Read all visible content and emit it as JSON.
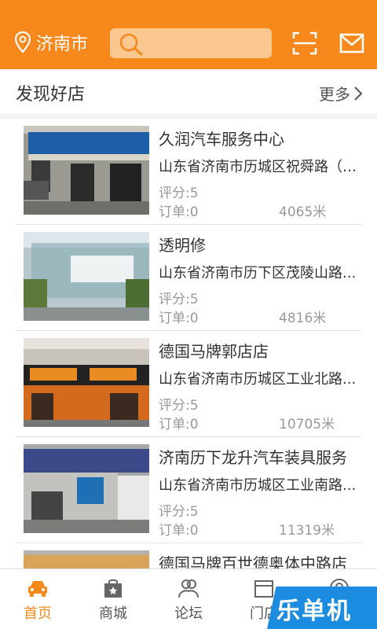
{
  "header": {
    "city": "济南市",
    "icons": {
      "location": "location-pin-icon",
      "search": "search-icon",
      "scan": "scan-icon",
      "message": "mail-icon"
    }
  },
  "section": {
    "title": "发现好店",
    "more": "更多"
  },
  "stores": [
    {
      "name": "久润汽车服务中心",
      "address": "山东省济南市历城区祝舜路（祝舜路与...",
      "rating": "评分:5",
      "orders": "订单:0",
      "distance": "4065米"
    },
    {
      "name": "透明修",
      "address": "山东省济南市历下区茂陵山路...",
      "rating": "评分:5",
      "orders": "订单:0",
      "distance": "4816米"
    },
    {
      "name": "德国马牌郭店店",
      "address": "山东省济南市历城区工业北路...",
      "rating": "评分:5",
      "orders": "订单:0",
      "distance": "10705米"
    },
    {
      "name": "济南历下龙升汽车装具服务",
      "address": "山东省济南市历城区工业南路...",
      "rating": "评分:5",
      "orders": "订单:0",
      "distance": "11319米"
    },
    {
      "name": "德国马牌百世德奥体中路店",
      "address": "",
      "rating": "",
      "orders": "",
      "distance": ""
    }
  ],
  "tabs": [
    {
      "label": "首页",
      "icon": "car-icon",
      "active": true
    },
    {
      "label": "商城",
      "icon": "shopping-bag-icon",
      "active": false
    },
    {
      "label": "论坛",
      "icon": "people-icon",
      "active": false
    },
    {
      "label": "门店",
      "icon": "store-icon",
      "active": false
    },
    {
      "label": "",
      "icon": "user-icon",
      "active": false
    }
  ],
  "watermark": "乐单机",
  "colors": {
    "brand": "#f7881c",
    "search_bg": "#fbc791",
    "watermark_bg": "#1c8ce0"
  }
}
